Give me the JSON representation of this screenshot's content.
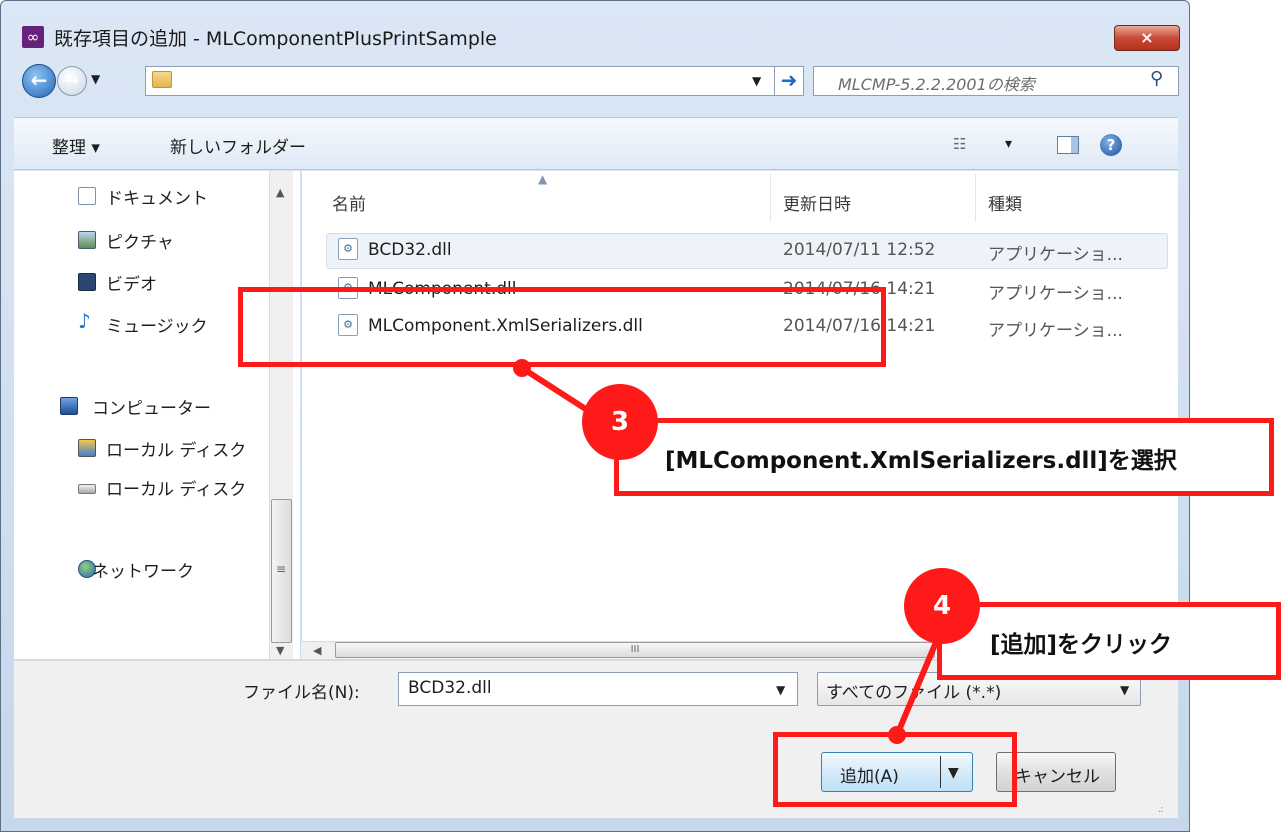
{
  "window": {
    "title": "既存項目の追加 - MLComponentPlusPrintSample",
    "close_label": "×"
  },
  "navbar": {
    "back_icon": "back-arrow-icon",
    "forward_icon": "forward-arrow-icon",
    "address_value": "",
    "search_placeholder": "MLCMP-5.2.2.2001の検索"
  },
  "toolbar": {
    "organize_label": "整理 ▾",
    "new_folder_label": "新しいフォルダー",
    "view_label": "▾"
  },
  "sidebar": {
    "items": [
      {
        "label": "ドキュメント",
        "icon": "document-icon"
      },
      {
        "label": "ピクチャ",
        "icon": "picture-icon"
      },
      {
        "label": "ビデオ",
        "icon": "video-icon"
      },
      {
        "label": "ミュージック",
        "icon": "music-icon"
      },
      {
        "label": "コンピューター",
        "icon": "computer-icon"
      },
      {
        "label": "ローカル ディスク",
        "icon": "local-disk-icon"
      },
      {
        "label": "ローカル ディスク",
        "icon": "drive-icon"
      },
      {
        "label": "ネットワーク",
        "icon": "network-icon"
      }
    ]
  },
  "file_list": {
    "columns": [
      "名前",
      "更新日時",
      "種類"
    ],
    "rows": [
      {
        "name": "BCD32.dll",
        "date": "2014/07/11 12:52",
        "type": "アプリケーショ..."
      },
      {
        "name": "MLComponent.dll",
        "date": "2014/07/16 14:21",
        "type": "アプリケーショ..."
      },
      {
        "name": "MLComponent.XmlSerializers.dll",
        "date": "2014/07/16 14:21",
        "type": "アプリケーショ..."
      }
    ],
    "hscroll_grip": "III"
  },
  "footer": {
    "filename_label": "ファイル名(N):",
    "filename_value": "BCD32.dll",
    "filter_value": "すべてのファイル (*.*)",
    "add_label": "追加(A)",
    "cancel_label": "キャンセル"
  },
  "annotations": {
    "step3_number": "3",
    "step3_text": "[MLComponent.XmlSerializers.dll]を選択",
    "step4_number": "4",
    "step4_text": "[追加]をクリック",
    "color": "#ff1a1a"
  }
}
